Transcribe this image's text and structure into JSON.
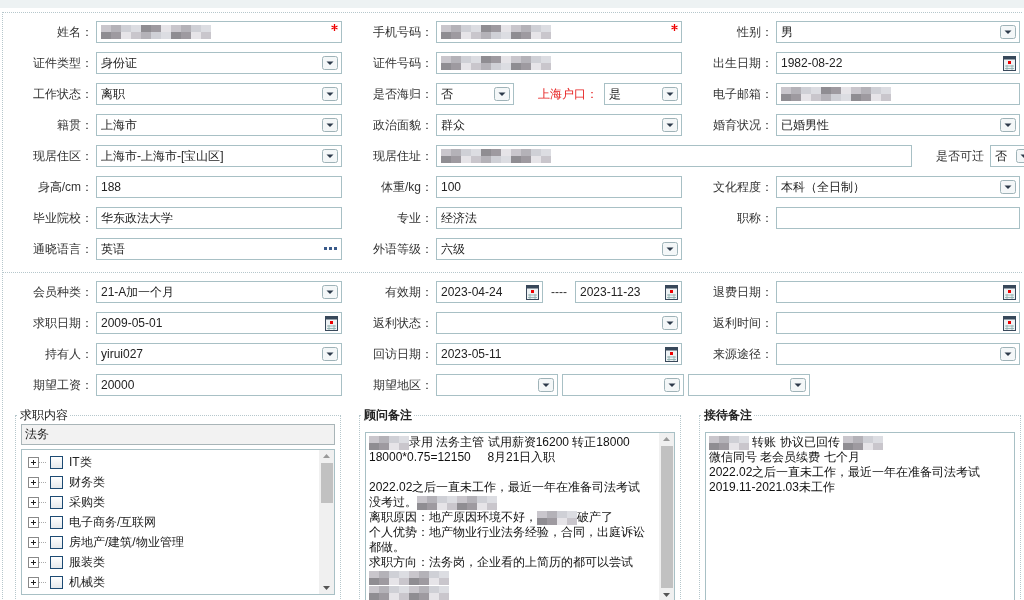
{
  "sections": [
    {
      "rows": [
        {
          "wide": false,
          "cells": [
            {
              "label": "姓名：",
              "parts": [
                {
                  "kind": "text",
                  "redacted": true,
                  "required": true
                }
              ]
            },
            {
              "label": "手机号码：",
              "parts": [
                {
                  "kind": "text",
                  "redacted": true,
                  "required": true
                }
              ]
            },
            {
              "label": "性别：",
              "parts": [
                {
                  "kind": "select",
                  "value": "男"
                }
              ]
            }
          ]
        },
        {
          "wide": false,
          "cells": [
            {
              "label": "证件类型：",
              "parts": [
                {
                  "kind": "select",
                  "value": "身份证"
                }
              ]
            },
            {
              "label": "证件号码：",
              "parts": [
                {
                  "kind": "text",
                  "redacted": true
                }
              ]
            },
            {
              "label": "出生日期：",
              "parts": [
                {
                  "kind": "date",
                  "value": "1982-08-22"
                }
              ]
            }
          ]
        },
        {
          "wide": false,
          "cells": [
            {
              "label": "工作状态：",
              "parts": [
                {
                  "kind": "select",
                  "value": "离职"
                }
              ]
            },
            {
              "label": "是否海归：",
              "parts": [
                {
                  "kind": "select",
                  "value": "否"
                },
                {
                  "kind": "label",
                  "text": "上海户口：",
                  "highlight": true
                },
                {
                  "kind": "select",
                  "value": "是"
                }
              ]
            },
            {
              "label": "电子邮箱：",
              "parts": [
                {
                  "kind": "text",
                  "redacted": true
                }
              ]
            }
          ]
        },
        {
          "wide": false,
          "cells": [
            {
              "label": "籍贯：",
              "parts": [
                {
                  "kind": "select",
                  "value": "上海市"
                }
              ]
            },
            {
              "label": "政治面貌：",
              "parts": [
                {
                  "kind": "select",
                  "value": "群众"
                }
              ]
            },
            {
              "label": "婚育状况：",
              "parts": [
                {
                  "kind": "select",
                  "value": "已婚男性"
                }
              ]
            }
          ]
        },
        {
          "wide": true,
          "cells": [
            {
              "label": "现居住区：",
              "parts": [
                {
                  "kind": "select",
                  "value": "上海市-上海市-[宝山区]"
                }
              ]
            },
            {
              "label": "现居住址：",
              "parts": [
                {
                  "kind": "text",
                  "redacted": true
                },
                {
                  "kind": "label",
                  "text": "是否可迁",
                  "highlight": false
                },
                {
                  "kind": "mini_select",
                  "value": "否"
                }
              ]
            }
          ]
        },
        {
          "wide": false,
          "cells": [
            {
              "label": "身高/cm：",
              "parts": [
                {
                  "kind": "text",
                  "value": "188"
                }
              ]
            },
            {
              "label": "体重/kg：",
              "parts": [
                {
                  "kind": "text",
                  "value": "100"
                }
              ]
            },
            {
              "label": "文化程度：",
              "parts": [
                {
                  "kind": "select",
                  "value": "本科（全日制）"
                }
              ]
            }
          ]
        },
        {
          "wide": false,
          "cells": [
            {
              "label": "毕业院校：",
              "parts": [
                {
                  "kind": "text",
                  "value": "华东政法大学"
                }
              ]
            },
            {
              "label": "专业：",
              "parts": [
                {
                  "kind": "text",
                  "value": "经济法"
                }
              ]
            },
            {
              "label": "职称：",
              "parts": [
                {
                  "kind": "text"
                }
              ]
            }
          ]
        },
        {
          "wide": false,
          "cells": [
            {
              "label": "通晓语言：",
              "parts": [
                {
                  "kind": "lookup",
                  "value": "英语"
                }
              ]
            },
            {
              "label": "外语等级：",
              "parts": [
                {
                  "kind": "select",
                  "value": "六级"
                }
              ]
            }
          ]
        }
      ]
    },
    {
      "rows": [
        {
          "wide": false,
          "cells": [
            {
              "label": "会员种类：",
              "parts": [
                {
                  "kind": "select",
                  "value": "21-A加一个月"
                }
              ]
            },
            {
              "label": "有效期：",
              "parts": [
                {
                  "kind": "date",
                  "value": "2023-04-24"
                },
                {
                  "kind": "dash",
                  "text": "----"
                },
                {
                  "kind": "date",
                  "value": "2023-11-23"
                }
              ]
            },
            {
              "label": "退费日期：",
              "parts": [
                {
                  "kind": "date"
                }
              ]
            }
          ]
        },
        {
          "wide": false,
          "cells": [
            {
              "label": "求职日期：",
              "parts": [
                {
                  "kind": "date",
                  "value": "2009-05-01"
                }
              ]
            },
            {
              "label": "返利状态：",
              "parts": [
                {
                  "kind": "select"
                }
              ]
            },
            {
              "label": "返利时间：",
              "parts": [
                {
                  "kind": "date"
                }
              ]
            }
          ]
        },
        {
          "wide": false,
          "cells": [
            {
              "label": "持有人：",
              "parts": [
                {
                  "kind": "select",
                  "value": "yirui027"
                }
              ]
            },
            {
              "label": "回访日期：",
              "parts": [
                {
                  "kind": "date",
                  "value": "2023-05-11"
                }
              ]
            },
            {
              "label": "来源途径：",
              "parts": [
                {
                  "kind": "select"
                }
              ]
            }
          ]
        },
        {
          "wide": true,
          "cells": [
            {
              "label": "期望工资：",
              "parts": [
                {
                  "kind": "text",
                  "value": "20000"
                }
              ]
            },
            {
              "label": "期望地区：",
              "parts": [
                {
                  "kind": "region_select"
                },
                {
                  "kind": "region_select"
                },
                {
                  "kind": "region_select"
                }
              ]
            }
          ]
        }
      ]
    }
  ],
  "job_panel": {
    "legend": "求职内容",
    "bold": false,
    "search": {
      "value": "法务"
    },
    "tree": [
      {
        "label": "IT类",
        "expanded": false,
        "checked": false
      },
      {
        "label": "财务类",
        "expanded": false,
        "checked": false
      },
      {
        "label": "采购类",
        "expanded": false,
        "checked": false
      },
      {
        "label": "电子商务/互联网",
        "expanded": false,
        "checked": false
      },
      {
        "label": "房地产/建筑/物业管理",
        "expanded": false,
        "checked": false
      },
      {
        "label": "服装类",
        "expanded": false,
        "checked": false
      },
      {
        "label": "机械类",
        "expanded": false,
        "checked": false
      }
    ]
  },
  "note_panels": [
    {
      "legend": "顾问备注",
      "bold": true,
      "scrollbar": true,
      "lines": [
        {
          "parts": [
            {
              "kind": "redacted"
            },
            {
              "kind": "text",
              "text": "录用 法务主管 试用薪资16200 转正18000"
            }
          ]
        },
        {
          "parts": [
            {
              "kind": "text",
              "text": "18000*0.75=12150     8月21日入职"
            }
          ]
        },
        {
          "gap_before": true,
          "parts": [
            {
              "kind": "text",
              "text": "2022.02之后一直未工作，最近一年在准备司法考试"
            }
          ]
        },
        {
          "parts": [
            {
              "kind": "text",
              "text": "没考过。"
            },
            {
              "kind": "redacted"
            },
            {
              "kind": "redacted"
            }
          ]
        },
        {
          "parts": [
            {
              "kind": "text",
              "text": "离职原因：地产原因环境不好，"
            },
            {
              "kind": "redacted"
            },
            {
              "kind": "text",
              "text": "破产了"
            }
          ]
        },
        {
          "parts": [
            {
              "kind": "text",
              "text": "个人优势：地产物业行业法务经验，合同，出庭诉讼"
            }
          ]
        },
        {
          "parts": [
            {
              "kind": "text",
              "text": "都做。"
            }
          ]
        },
        {
          "parts": [
            {
              "kind": "text",
              "text": "求职方向：法务岗，企业看的上简历的都可以尝试"
            }
          ]
        },
        {
          "parts": [
            {
              "kind": "redacted"
            },
            {
              "kind": "redacted"
            }
          ]
        },
        {
          "parts": [
            {
              "kind": "redacted"
            },
            {
              "kind": "redacted"
            }
          ]
        }
      ]
    },
    {
      "legend": "接待备注",
      "bold": true,
      "scrollbar": false,
      "lines": [
        {
          "parts": [
            {
              "kind": "redacted"
            },
            {
              "kind": "text",
              "text": " 转账 协议已回传 "
            },
            {
              "kind": "redacted"
            }
          ]
        },
        {
          "parts": [
            {
              "kind": "text",
              "text": "微信同号 老会员续费 七个月"
            }
          ]
        },
        {
          "parts": [
            {
              "kind": "text",
              "text": "2022.02之后一直未工作，最近一年在准备司法考试"
            }
          ]
        },
        {
          "parts": [
            {
              "kind": "text",
              "text": "2019.11-2021.03未工作"
            }
          ]
        }
      ]
    }
  ]
}
